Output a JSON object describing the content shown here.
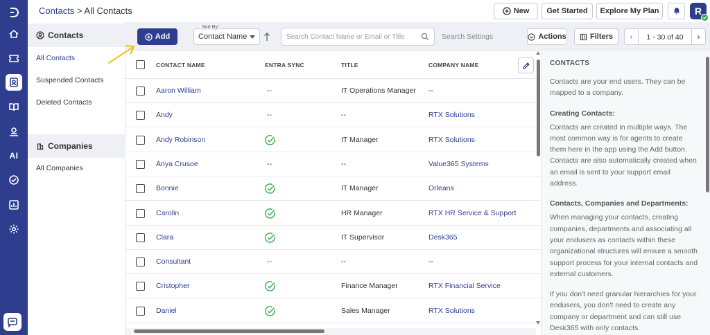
{
  "header": {
    "breadcrumb_link": "Contacts",
    "breadcrumb_sep": " > ",
    "breadcrumb_current": "All Contacts",
    "new_label": "New",
    "get_started_label": "Get Started",
    "explore_plan_label": "Explore My Plan",
    "avatar_initial": "R"
  },
  "rail": {
    "ai_label": "AI"
  },
  "sidebar": {
    "contacts_heading": "Contacts",
    "contacts_items": [
      "All Contacts",
      "Suspended Contacts",
      "Deleted Contacts"
    ],
    "companies_heading": "Companies",
    "companies_items": [
      "All Companies"
    ]
  },
  "toolbar": {
    "add_label": "Add",
    "sort_by_label": "Sort By:",
    "sort_value": "Contact Name",
    "search_placeholder": "Search Contact Name or Email or Title",
    "search_settings_label": "Search Settings",
    "actions_label": "Actions",
    "filters_label": "Filters",
    "pager_text": "1 - 30 of 40"
  },
  "table": {
    "columns": [
      "Contact Name",
      "Entra Sync",
      "Title",
      "Company Name"
    ],
    "rows": [
      {
        "name": "Aaron William",
        "sync": "--",
        "title": "IT Operations Manager",
        "company": "--"
      },
      {
        "name": "Andy",
        "sync": "--",
        "title": "--",
        "company": "RTX Solutions"
      },
      {
        "name": "Andy Robinson",
        "sync": "check",
        "title": "IT Manager",
        "company": "RTX Solutions"
      },
      {
        "name": "Anya Crusoe",
        "sync": "--",
        "title": "--",
        "company": "Value365 Systems"
      },
      {
        "name": "Bonnie",
        "sync": "check",
        "title": "IT Manager",
        "company": "Orleans"
      },
      {
        "name": "Carolin",
        "sync": "check",
        "title": "HR Manager",
        "company": "RTX HR Service & Support"
      },
      {
        "name": "Clara",
        "sync": "check",
        "title": "IT Supervisor",
        "company": "Desk365"
      },
      {
        "name": "Consultant",
        "sync": "--",
        "title": "--",
        "company": "--"
      },
      {
        "name": "Cristopher",
        "sync": "check",
        "title": "Finance Manager",
        "company": "RTX Financial Service"
      },
      {
        "name": "Daniel",
        "sync": "check",
        "title": "Sales Manager",
        "company": "RTX Solutions"
      }
    ]
  },
  "help": {
    "title": "CONTACTS",
    "intro": "Contacts are your end users. They can be mapped to a company.",
    "creating_heading": "Creating Contacts:",
    "creating_text": "Contacts are created in multiple ways. The most common way is for agents to create them here in the app using the Add button. Contacts are also automatically created when an email is sent to your support email address.",
    "ccd_heading": "Contacts, Companies and Departments:",
    "ccd_text": "When managing your contacts, creating companies, departments and associating all your endusers as contacts within these organizational structures will ensure a smooth support process for your internal contacts and external customers.",
    "granular_text": "If you don't need granular hierarchies for your endusers, you don't need to create any company or department and can still use Desk365 with only contacts."
  },
  "colors": {
    "brand": "#2f3d8f",
    "success": "#2eaa46",
    "annotation": "#f2c230"
  }
}
